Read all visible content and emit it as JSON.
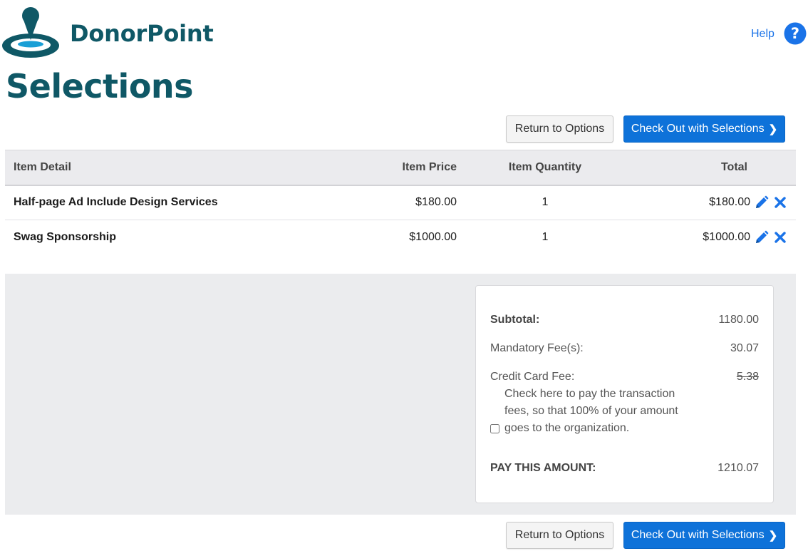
{
  "brand": {
    "name": "DonorPoint"
  },
  "header": {
    "help_label": "Help"
  },
  "page": {
    "title": "Selections"
  },
  "actions": {
    "return_label": "Return to Options",
    "checkout_label": "Check Out with Selections",
    "checkout_icon": "chevron-right"
  },
  "table": {
    "headers": {
      "detail": "Item Detail",
      "price": "Item Price",
      "quantity": "Item Quantity",
      "total": "Total"
    },
    "rows": [
      {
        "detail": "Half-page Ad Include Design Services",
        "price": "$180.00",
        "quantity": "1",
        "total": "$180.00"
      },
      {
        "detail": "Swag Sponsorship",
        "price": "$1000.00",
        "quantity": "1",
        "total": "$1000.00"
      }
    ],
    "row_actions": [
      "pencil-icon",
      "x-icon"
    ]
  },
  "summary": {
    "subtotal_label": "Subtotal:",
    "subtotal_value": "1180.00",
    "mandatory_fee_label": "Mandatory Fee(s):",
    "mandatory_fee_value": "30.07",
    "credit_card_fee_label": "Credit Card Fee:",
    "credit_card_fee_value": "5.38",
    "fee_checkbox_note": "Check here to pay the transaction fees, so that 100% of your amount goes to the organization.",
    "fee_checkbox_checked": false,
    "pay_label": "PAY THIS AMOUNT:",
    "pay_value": "1210.07"
  },
  "colors": {
    "brand_teal": "#0f5866",
    "primary_blue": "#0e72d9",
    "icon_blue": "#1a73e8",
    "band_gray": "#ebecee"
  }
}
